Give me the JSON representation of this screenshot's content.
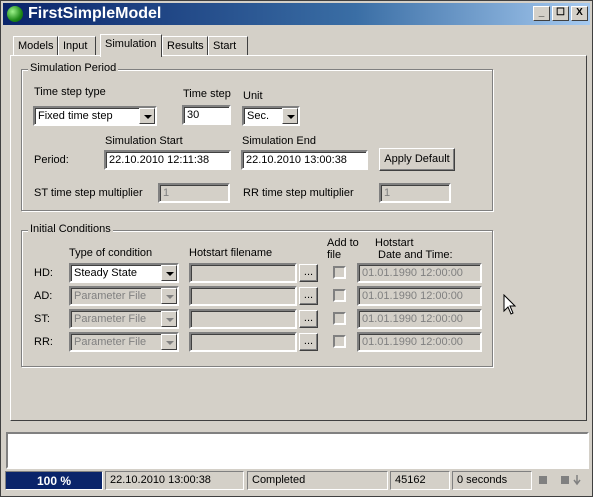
{
  "window": {
    "title": "FirstSimpleModel",
    "min": "_",
    "max": "☐",
    "close": "X"
  },
  "tabs": [
    {
      "label": "Models"
    },
    {
      "label": "Input"
    },
    {
      "label": "Simulation"
    },
    {
      "label": "Results"
    },
    {
      "label": "Start"
    }
  ],
  "period": {
    "group_title": "Simulation Period",
    "type_label": "Time step type",
    "type_value": "Fixed time step",
    "step_label": "Time step",
    "step_value": "30",
    "unit_label": "Unit",
    "unit_value": "Sec.",
    "start_label": "Simulation Start",
    "end_label": "Simulation End",
    "period_label": "Period:",
    "start_value": "22.10.2010 12:11:38",
    "end_value": "22.10.2010 13:00:38",
    "apply_label": "Apply Default",
    "st_label": "ST time step multiplier",
    "st_value": "1",
    "rr_label": "RR time step multiplier",
    "rr_value": "1"
  },
  "initial": {
    "group_title": "Initial Conditions",
    "col_type": "Type of condition",
    "col_file": "Hotstart filename",
    "col_add": "Add to file",
    "col_add1": "Add to",
    "col_add2": "file",
    "col_dt1": "Hotstart",
    "col_dt2": "Date and Time:",
    "browse": "...",
    "rows": [
      {
        "label": "HD:",
        "type": "Steady State",
        "date": "01.01.1990 12:00:00"
      },
      {
        "label": "AD:",
        "type": "Parameter File",
        "date": "01.01.1990 12:00:00"
      },
      {
        "label": "ST:",
        "type": "Parameter File",
        "date": "01.01.1990 12:00:00"
      },
      {
        "label": "RR:",
        "type": "Parameter File",
        "date": "01.01.1990 12:00:00"
      }
    ]
  },
  "status": {
    "progress": "100 %",
    "progress_fraction": 1.0,
    "time": "22.10.2010 13:00:38",
    "state": "Completed",
    "count": "45162",
    "duration": "0 seconds"
  },
  "colors": {
    "titlebar": "#0a246a",
    "progress": "#0a246a"
  }
}
